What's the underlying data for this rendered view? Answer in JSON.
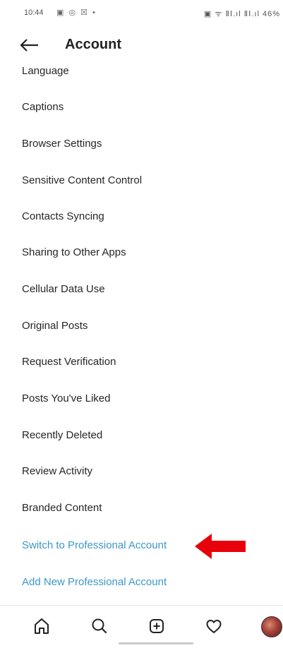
{
  "status_bar": {
    "time": "10:44",
    "notification_icons": "▣ ◎ ☒ •",
    "right_icons": "▣ ᯤ ⅡⅠ.ıl ⅡⅠ.ıl 46%"
  },
  "header": {
    "title": "Account"
  },
  "menu": {
    "items": [
      {
        "label": "Language"
      },
      {
        "label": "Captions"
      },
      {
        "label": "Browser Settings"
      },
      {
        "label": "Sensitive Content Control"
      },
      {
        "label": "Contacts Syncing"
      },
      {
        "label": "Sharing to Other Apps"
      },
      {
        "label": "Cellular Data Use"
      },
      {
        "label": "Original Posts"
      },
      {
        "label": "Request Verification"
      },
      {
        "label": "Posts You've Liked"
      },
      {
        "label": "Recently Deleted"
      },
      {
        "label": "Review Activity"
      },
      {
        "label": "Branded Content"
      },
      {
        "label": "Switch to Professional Account"
      },
      {
        "label": "Add New Professional Account"
      }
    ]
  },
  "bottom_nav": {
    "icons": [
      "home-icon",
      "search-icon",
      "create-post-icon",
      "heart-icon",
      "profile-avatar"
    ]
  },
  "colors": {
    "link": "#3c98c8",
    "annotation_arrow": "#e8000b",
    "text": "#262626"
  }
}
